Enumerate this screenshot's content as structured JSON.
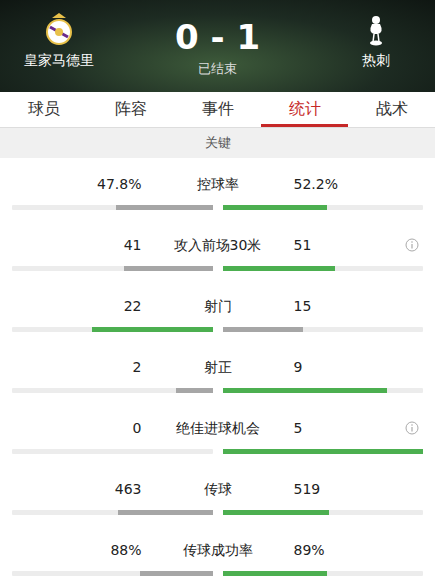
{
  "header": {
    "home": {
      "name": "皇家马德里"
    },
    "away": {
      "name": "热刺"
    },
    "score": "0 - 1",
    "status": "已结束"
  },
  "tabs": [
    {
      "label": "球员",
      "selected": false
    },
    {
      "label": "阵容",
      "selected": false
    },
    {
      "label": "事件",
      "selected": false
    },
    {
      "label": "统计",
      "selected": true
    },
    {
      "label": "战术",
      "selected": false
    }
  ],
  "section": {
    "title": "关键"
  },
  "stats": [
    {
      "label": "控球率",
      "info": false,
      "home": {
        "value": "47.8%",
        "level": 0.48,
        "color": "#a6a6a6"
      },
      "away": {
        "value": "52.2%",
        "level": 0.52,
        "color": "#4caf50"
      }
    },
    {
      "label": "攻入前场30米",
      "info": true,
      "home": {
        "value": "41",
        "level": 0.44,
        "color": "#a6a6a6"
      },
      "away": {
        "value": "51",
        "level": 0.56,
        "color": "#4caf50"
      }
    },
    {
      "label": "射门",
      "info": false,
      "home": {
        "value": "22",
        "level": 0.6,
        "color": "#4caf50"
      },
      "away": {
        "value": "15",
        "level": 0.4,
        "color": "#a6a6a6"
      }
    },
    {
      "label": "射正",
      "info": false,
      "home": {
        "value": "2",
        "level": 0.18,
        "color": "#a6a6a6"
      },
      "away": {
        "value": "9",
        "level": 0.82,
        "color": "#4caf50"
      }
    },
    {
      "label": "绝佳进球机会",
      "info": true,
      "home": {
        "value": "0",
        "level": 0,
        "color": "#a6a6a6"
      },
      "away": {
        "value": "5",
        "level": 1,
        "color": "#4caf50"
      }
    },
    {
      "label": "传球",
      "info": false,
      "home": {
        "value": "463",
        "level": 0.47,
        "color": "#a6a6a6"
      },
      "away": {
        "value": "519",
        "level": 0.53,
        "color": "#4caf50"
      }
    },
    {
      "label": "传球成功率",
      "info": false,
      "home": {
        "value": "88%",
        "level": 0.36,
        "color": "#a6a6a6"
      },
      "away": {
        "value": "89%",
        "level": 0.52,
        "color": "#4caf50"
      }
    }
  ]
}
